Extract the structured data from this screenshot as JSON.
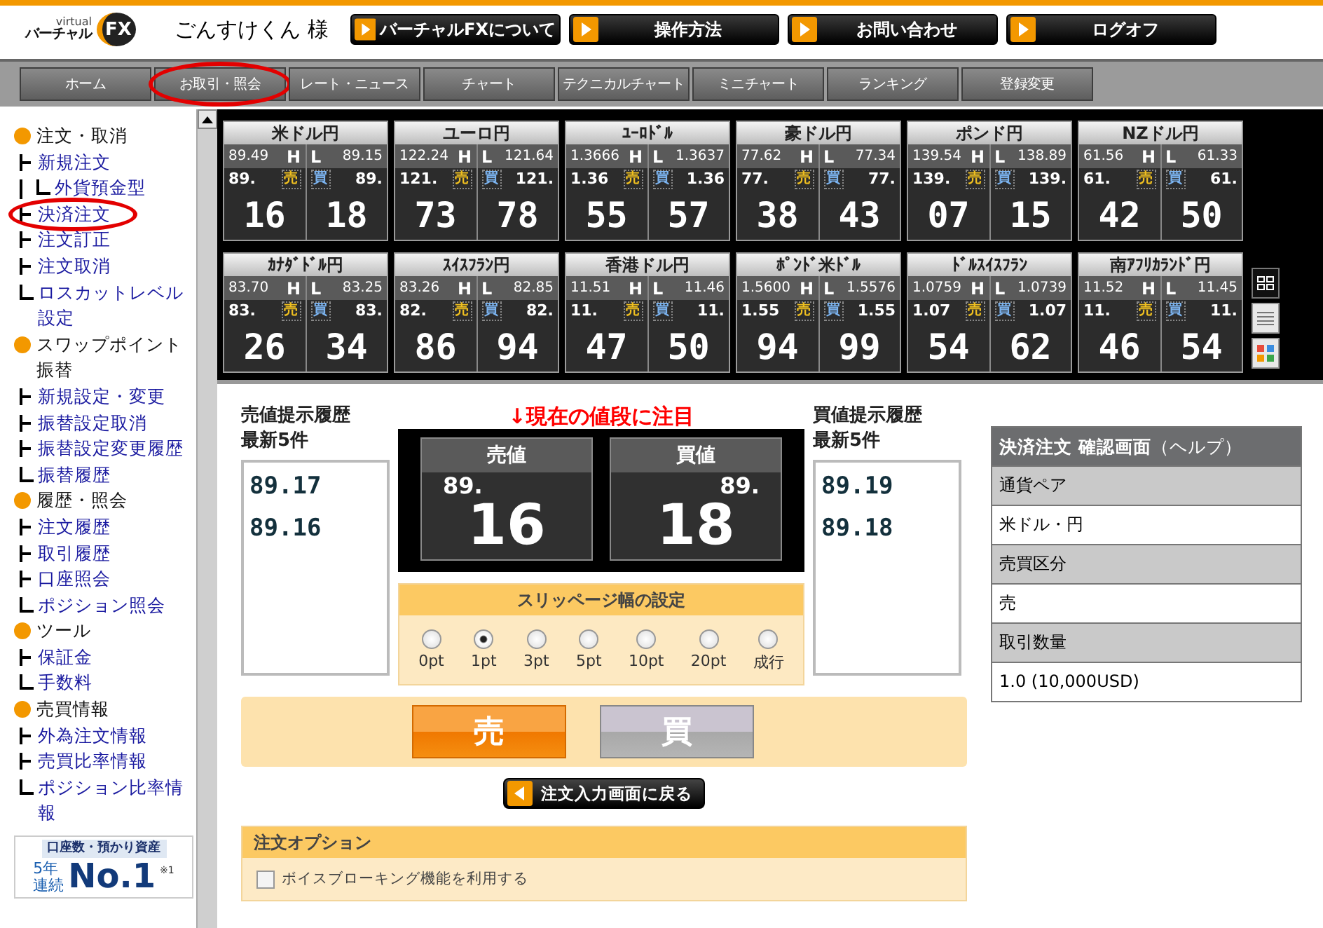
{
  "header": {
    "logo": {
      "small": "virtual",
      "main": "バーチャル",
      "badge": "FX"
    },
    "user": "ごんすけくん 様",
    "buttons": [
      "バーチャルFXについて",
      "操作方法",
      "お問い合わせ",
      "ログオフ"
    ]
  },
  "nav": [
    {
      "label": "ホーム",
      "circled": false
    },
    {
      "label": "お取引・照会",
      "circled": true
    },
    {
      "label": "レート・ニュース",
      "circled": false
    },
    {
      "label": "チャート",
      "circled": false
    },
    {
      "label": "テクニカルチャート",
      "circled": false
    },
    {
      "label": "ミニチャート",
      "circled": false
    },
    {
      "label": "ランキング",
      "circled": false
    },
    {
      "label": "登録変更",
      "circled": false
    }
  ],
  "sidebar": {
    "sections": [
      {
        "title": "注文・取消",
        "items": [
          {
            "label": "新規注文",
            "circled": false,
            "children": [
              {
                "label": "外貨預金型",
                "circled": false
              }
            ]
          },
          {
            "label": "決済注文",
            "circled": true
          },
          {
            "label": "注文訂正",
            "circled": false
          },
          {
            "label": "注文取消",
            "circled": false
          },
          {
            "label": "ロスカットレベル設定",
            "circled": false
          }
        ]
      },
      {
        "title": "スワップポイント振替",
        "items": [
          {
            "label": "新規設定・変更",
            "circled": false
          },
          {
            "label": "振替設定取消",
            "circled": false
          },
          {
            "label": "振替設定変更履歴",
            "circled": false
          },
          {
            "label": "振替履歴",
            "circled": false
          }
        ]
      },
      {
        "title": "履歴・照会",
        "items": [
          {
            "label": "注文履歴",
            "circled": false
          },
          {
            "label": "取引履歴",
            "circled": false
          },
          {
            "label": "口座照会",
            "circled": false
          },
          {
            "label": "ポジション照会",
            "circled": false
          }
        ]
      },
      {
        "title": "ツール",
        "items": [
          {
            "label": "保証金",
            "circled": false
          },
          {
            "label": "手数料",
            "circled": false
          }
        ]
      },
      {
        "title": "売買情報",
        "items": [
          {
            "label": "外為注文情報",
            "circled": false
          },
          {
            "label": "売買比率情報",
            "circled": false
          },
          {
            "label": "ポジション比率情報",
            "circled": false
          }
        ]
      }
    ],
    "banner": {
      "top": "口座数・預かり資産",
      "years": "5年",
      "streak": "連続",
      "rank": "No.1",
      "note": "※1"
    }
  },
  "rates": {
    "tiles": [
      {
        "pair": "米ドル円",
        "high": "89.49",
        "h": "H",
        "l": "L",
        "low": "89.15",
        "bid_big": "89.",
        "sell": "売",
        "buy": "買",
        "ask_big": "89.",
        "bid": "16",
        "ask": "18"
      },
      {
        "pair": "ユーロ円",
        "high": "122.24",
        "h": "H",
        "l": "L",
        "low": "121.64",
        "bid_big": "121.",
        "sell": "売",
        "buy": "買",
        "ask_big": "121.",
        "bid": "73",
        "ask": "78"
      },
      {
        "pair": "ﾕｰﾛﾄﾞﾙ",
        "high": "1.3666",
        "h": "H",
        "l": "L",
        "low": "1.3637",
        "bid_big": "1.36",
        "sell": "売",
        "buy": "買",
        "ask_big": "1.36",
        "bid": "55",
        "ask": "57"
      },
      {
        "pair": "豪ドル円",
        "high": "77.62",
        "h": "H",
        "l": "L",
        "low": "77.34",
        "bid_big": "77.",
        "sell": "売",
        "buy": "買",
        "ask_big": "77.",
        "bid": "38",
        "ask": "43"
      },
      {
        "pair": "ポンド円",
        "high": "139.54",
        "h": "H",
        "l": "L",
        "low": "138.89",
        "bid_big": "139.",
        "sell": "売",
        "buy": "買",
        "ask_big": "139.",
        "bid": "07",
        "ask": "15"
      },
      {
        "pair": "NZドル円",
        "high": "61.56",
        "h": "H",
        "l": "L",
        "low": "61.33",
        "bid_big": "61.",
        "sell": "売",
        "buy": "買",
        "ask_big": "61.",
        "bid": "42",
        "ask": "50"
      },
      {
        "pair": "ｶﾅﾀﾞﾄﾞﾙ円",
        "high": "83.70",
        "h": "H",
        "l": "L",
        "low": "83.25",
        "bid_big": "83.",
        "sell": "売",
        "buy": "買",
        "ask_big": "83.",
        "bid": "26",
        "ask": "34"
      },
      {
        "pair": "ｽｲｽﾌﾗﾝ円",
        "high": "83.26",
        "h": "H",
        "l": "L",
        "low": "82.85",
        "bid_big": "82.",
        "sell": "売",
        "buy": "買",
        "ask_big": "82.",
        "bid": "86",
        "ask": "94"
      },
      {
        "pair": "香港ドル円",
        "high": "11.51",
        "h": "H",
        "l": "L",
        "low": "11.46",
        "bid_big": "11.",
        "sell": "売",
        "buy": "買",
        "ask_big": "11.",
        "bid": "47",
        "ask": "50"
      },
      {
        "pair": "ﾎﾟﾝﾄﾞ米ﾄﾞﾙ",
        "high": "1.5600",
        "h": "H",
        "l": "L",
        "low": "1.5576",
        "bid_big": "1.55",
        "sell": "売",
        "buy": "買",
        "ask_big": "1.55",
        "bid": "94",
        "ask": "99"
      },
      {
        "pair": "ﾄﾞﾙｽｲｽﾌﾗﾝ",
        "high": "1.0759",
        "h": "H",
        "l": "L",
        "low": "1.0739",
        "bid_big": "1.07",
        "sell": "売",
        "buy": "買",
        "ask_big": "1.07",
        "bid": "54",
        "ask": "62"
      },
      {
        "pair": "南ｱﾌﾘｶﾗﾝﾄﾞ円",
        "high": "11.52",
        "h": "H",
        "l": "L",
        "low": "11.45",
        "bid_big": "11.",
        "sell": "売",
        "buy": "買",
        "ask_big": "11.",
        "bid": "46",
        "ask": "54"
      }
    ],
    "views": [
      {
        "kind": "grid",
        "selected": true
      },
      {
        "kind": "list",
        "selected": false
      },
      {
        "kind": "tiles",
        "selected": false
      }
    ]
  },
  "sell_history": {
    "title": "売値提示履歴",
    "subtitle": "最新5件",
    "values": [
      "89.17",
      "89.16"
    ]
  },
  "buy_history": {
    "title": "買値提示履歴",
    "subtitle": "最新5件",
    "values": [
      "89.19",
      "89.18"
    ]
  },
  "annotation": "↓現在の値段に注目",
  "quote": [
    {
      "label": "売値",
      "big": "89.",
      "pips": "16"
    },
    {
      "label": "買値",
      "big": "89.",
      "pips": "18"
    }
  ],
  "slippage": {
    "title": "スリッページ幅の設定",
    "options": [
      {
        "label": "0pt",
        "selected": false
      },
      {
        "label": "1pt",
        "selected": true
      },
      {
        "label": "3pt",
        "selected": false
      },
      {
        "label": "5pt",
        "selected": false
      },
      {
        "label": "10pt",
        "selected": false
      },
      {
        "label": "20pt",
        "selected": false
      },
      {
        "label": "成行",
        "selected": false
      }
    ]
  },
  "sides": [
    {
      "label": "売",
      "selected": true
    },
    {
      "label": "買",
      "selected": false
    }
  ],
  "back_button": "注文入力画面に戻る",
  "options": {
    "title": "注文オプション",
    "items": [
      {
        "label": "ボイスブローキング機能を利用する",
        "checked": false
      }
    ]
  },
  "help": {
    "title": "**決済注文 確認画面**（ヘルプ）",
    "rows": [
      {
        "kind": "label",
        "text": "通貨ペア"
      },
      {
        "kind": "value",
        "text": "米ドル・円"
      },
      {
        "kind": "label",
        "text": "売買区分"
      },
      {
        "kind": "value",
        "text": "売"
      },
      {
        "kind": "label",
        "text": "取引数量"
      },
      {
        "kind": "value",
        "text": "1.0 (10,000USD)"
      }
    ]
  }
}
